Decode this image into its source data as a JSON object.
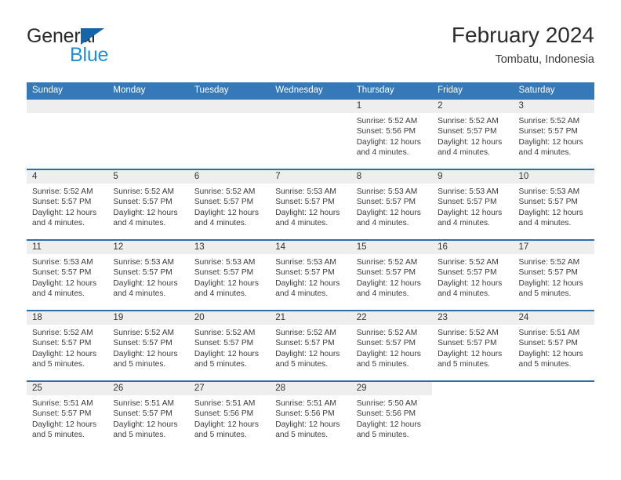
{
  "brand": {
    "word1": "General",
    "word2": "Blue",
    "triangle_color": "#1565a8",
    "blue_color": "#1f8fd6"
  },
  "header": {
    "title": "February 2024",
    "location": "Tombatu, Indonesia"
  },
  "theme": {
    "header_blue": "#3579b8",
    "row_divider_blue": "#2f6da8",
    "daynum_band": "#eeeeee"
  },
  "labels": {
    "sunrise": "Sunrise:",
    "sunset": "Sunset:",
    "daylight": "Daylight:"
  },
  "columns": [
    "Sunday",
    "Monday",
    "Tuesday",
    "Wednesday",
    "Thursday",
    "Friday",
    "Saturday"
  ],
  "weeks": [
    [
      {
        "day": "",
        "empty": true
      },
      {
        "day": "",
        "empty": true
      },
      {
        "day": "",
        "empty": true
      },
      {
        "day": "",
        "empty": true
      },
      {
        "day": "1",
        "sunrise": "Sunrise: 5:52 AM",
        "sunset": "Sunset: 5:56 PM",
        "daylight1": "Daylight: 12 hours",
        "daylight2": "and 4 minutes."
      },
      {
        "day": "2",
        "sunrise": "Sunrise: 5:52 AM",
        "sunset": "Sunset: 5:57 PM",
        "daylight1": "Daylight: 12 hours",
        "daylight2": "and 4 minutes."
      },
      {
        "day": "3",
        "sunrise": "Sunrise: 5:52 AM",
        "sunset": "Sunset: 5:57 PM",
        "daylight1": "Daylight: 12 hours",
        "daylight2": "and 4 minutes."
      }
    ],
    [
      {
        "day": "4",
        "sunrise": "Sunrise: 5:52 AM",
        "sunset": "Sunset: 5:57 PM",
        "daylight1": "Daylight: 12 hours",
        "daylight2": "and 4 minutes."
      },
      {
        "day": "5",
        "sunrise": "Sunrise: 5:52 AM",
        "sunset": "Sunset: 5:57 PM",
        "daylight1": "Daylight: 12 hours",
        "daylight2": "and 4 minutes."
      },
      {
        "day": "6",
        "sunrise": "Sunrise: 5:52 AM",
        "sunset": "Sunset: 5:57 PM",
        "daylight1": "Daylight: 12 hours",
        "daylight2": "and 4 minutes."
      },
      {
        "day": "7",
        "sunrise": "Sunrise: 5:53 AM",
        "sunset": "Sunset: 5:57 PM",
        "daylight1": "Daylight: 12 hours",
        "daylight2": "and 4 minutes."
      },
      {
        "day": "8",
        "sunrise": "Sunrise: 5:53 AM",
        "sunset": "Sunset: 5:57 PM",
        "daylight1": "Daylight: 12 hours",
        "daylight2": "and 4 minutes."
      },
      {
        "day": "9",
        "sunrise": "Sunrise: 5:53 AM",
        "sunset": "Sunset: 5:57 PM",
        "daylight1": "Daylight: 12 hours",
        "daylight2": "and 4 minutes."
      },
      {
        "day": "10",
        "sunrise": "Sunrise: 5:53 AM",
        "sunset": "Sunset: 5:57 PM",
        "daylight1": "Daylight: 12 hours",
        "daylight2": "and 4 minutes."
      }
    ],
    [
      {
        "day": "11",
        "sunrise": "Sunrise: 5:53 AM",
        "sunset": "Sunset: 5:57 PM",
        "daylight1": "Daylight: 12 hours",
        "daylight2": "and 4 minutes."
      },
      {
        "day": "12",
        "sunrise": "Sunrise: 5:53 AM",
        "sunset": "Sunset: 5:57 PM",
        "daylight1": "Daylight: 12 hours",
        "daylight2": "and 4 minutes."
      },
      {
        "day": "13",
        "sunrise": "Sunrise: 5:53 AM",
        "sunset": "Sunset: 5:57 PM",
        "daylight1": "Daylight: 12 hours",
        "daylight2": "and 4 minutes."
      },
      {
        "day": "14",
        "sunrise": "Sunrise: 5:53 AM",
        "sunset": "Sunset: 5:57 PM",
        "daylight1": "Daylight: 12 hours",
        "daylight2": "and 4 minutes."
      },
      {
        "day": "15",
        "sunrise": "Sunrise: 5:52 AM",
        "sunset": "Sunset: 5:57 PM",
        "daylight1": "Daylight: 12 hours",
        "daylight2": "and 4 minutes."
      },
      {
        "day": "16",
        "sunrise": "Sunrise: 5:52 AM",
        "sunset": "Sunset: 5:57 PM",
        "daylight1": "Daylight: 12 hours",
        "daylight2": "and 4 minutes."
      },
      {
        "day": "17",
        "sunrise": "Sunrise: 5:52 AM",
        "sunset": "Sunset: 5:57 PM",
        "daylight1": "Daylight: 12 hours",
        "daylight2": "and 5 minutes."
      }
    ],
    [
      {
        "day": "18",
        "sunrise": "Sunrise: 5:52 AM",
        "sunset": "Sunset: 5:57 PM",
        "daylight1": "Daylight: 12 hours",
        "daylight2": "and 5 minutes."
      },
      {
        "day": "19",
        "sunrise": "Sunrise: 5:52 AM",
        "sunset": "Sunset: 5:57 PM",
        "daylight1": "Daylight: 12 hours",
        "daylight2": "and 5 minutes."
      },
      {
        "day": "20",
        "sunrise": "Sunrise: 5:52 AM",
        "sunset": "Sunset: 5:57 PM",
        "daylight1": "Daylight: 12 hours",
        "daylight2": "and 5 minutes."
      },
      {
        "day": "21",
        "sunrise": "Sunrise: 5:52 AM",
        "sunset": "Sunset: 5:57 PM",
        "daylight1": "Daylight: 12 hours",
        "daylight2": "and 5 minutes."
      },
      {
        "day": "22",
        "sunrise": "Sunrise: 5:52 AM",
        "sunset": "Sunset: 5:57 PM",
        "daylight1": "Daylight: 12 hours",
        "daylight2": "and 5 minutes."
      },
      {
        "day": "23",
        "sunrise": "Sunrise: 5:52 AM",
        "sunset": "Sunset: 5:57 PM",
        "daylight1": "Daylight: 12 hours",
        "daylight2": "and 5 minutes."
      },
      {
        "day": "24",
        "sunrise": "Sunrise: 5:51 AM",
        "sunset": "Sunset: 5:57 PM",
        "daylight1": "Daylight: 12 hours",
        "daylight2": "and 5 minutes."
      }
    ],
    [
      {
        "day": "25",
        "sunrise": "Sunrise: 5:51 AM",
        "sunset": "Sunset: 5:57 PM",
        "daylight1": "Daylight: 12 hours",
        "daylight2": "and 5 minutes."
      },
      {
        "day": "26",
        "sunrise": "Sunrise: 5:51 AM",
        "sunset": "Sunset: 5:57 PM",
        "daylight1": "Daylight: 12 hours",
        "daylight2": "and 5 minutes."
      },
      {
        "day": "27",
        "sunrise": "Sunrise: 5:51 AM",
        "sunset": "Sunset: 5:56 PM",
        "daylight1": "Daylight: 12 hours",
        "daylight2": "and 5 minutes."
      },
      {
        "day": "28",
        "sunrise": "Sunrise: 5:51 AM",
        "sunset": "Sunset: 5:56 PM",
        "daylight1": "Daylight: 12 hours",
        "daylight2": "and 5 minutes."
      },
      {
        "day": "29",
        "sunrise": "Sunrise: 5:50 AM",
        "sunset": "Sunset: 5:56 PM",
        "daylight1": "Daylight: 12 hours",
        "daylight2": "and 5 minutes."
      },
      {
        "day": "",
        "blank": true
      },
      {
        "day": "",
        "blank": true
      }
    ]
  ]
}
